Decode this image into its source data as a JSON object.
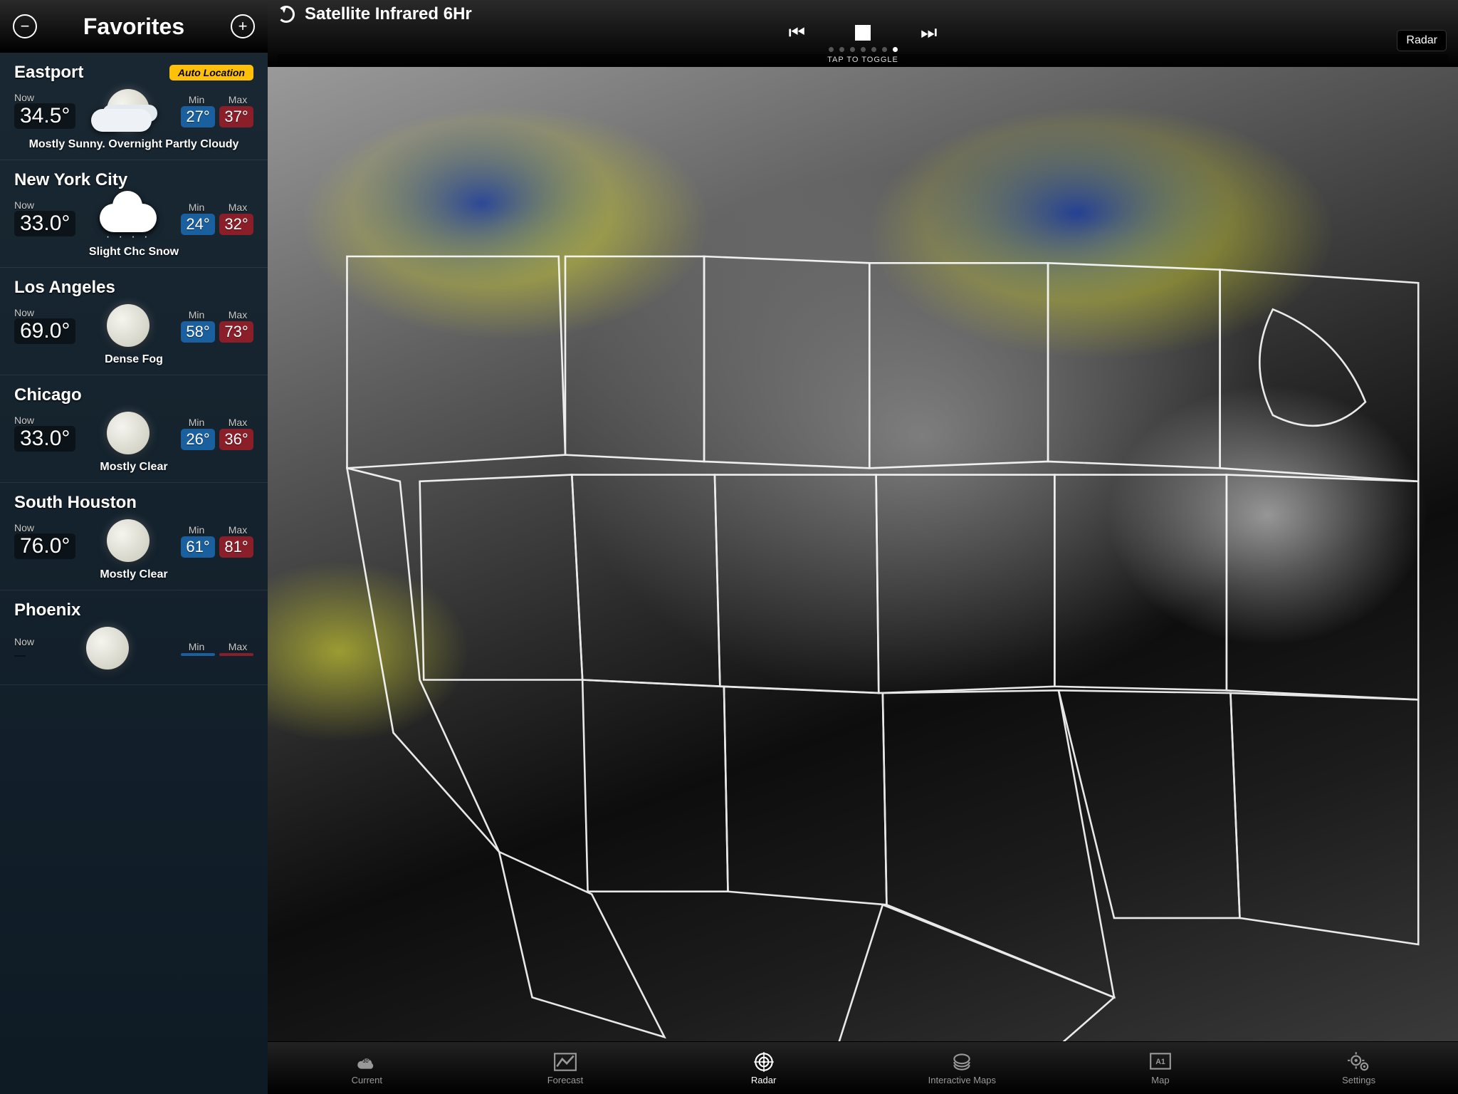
{
  "sidebar": {
    "title": "Favorites",
    "auto_location_label": "Auto Location",
    "now_label": "Now",
    "min_label": "Min",
    "max_label": "Max",
    "items": [
      {
        "name": "Eastport",
        "auto": true,
        "now": "34.5°",
        "min": "27°",
        "max": "37°",
        "icon": "moon-cloudy",
        "desc": "Mostly Sunny. Overnight Partly Cloudy"
      },
      {
        "name": "New York City",
        "auto": false,
        "now": "33.0°",
        "min": "24°",
        "max": "32°",
        "icon": "cloud-snow",
        "desc": "Slight Chc Snow"
      },
      {
        "name": "Los Angeles",
        "auto": false,
        "now": "69.0°",
        "min": "58°",
        "max": "73°",
        "icon": "moon",
        "desc": "Dense Fog"
      },
      {
        "name": "Chicago",
        "auto": false,
        "now": "33.0°",
        "min": "26°",
        "max": "36°",
        "icon": "moon",
        "desc": "Mostly Clear"
      },
      {
        "name": "South Houston",
        "auto": false,
        "now": "76.0°",
        "min": "61°",
        "max": "81°",
        "icon": "moon",
        "desc": "Mostly Clear"
      },
      {
        "name": "Phoenix",
        "auto": false,
        "now": "",
        "min": "",
        "max": "",
        "icon": "moon",
        "desc": ""
      }
    ]
  },
  "topbar": {
    "title": "Satellite Infrared 6Hr",
    "radar_button": "Radar",
    "tap_toggle": "TAP TO TOGGLE",
    "frames": 7,
    "active_frame": 6
  },
  "tabs": [
    {
      "id": "current",
      "label": "Current",
      "icon": "cloud-temp"
    },
    {
      "id": "forecast",
      "label": "Forecast",
      "icon": "chart-line"
    },
    {
      "id": "radar",
      "label": "Radar",
      "icon": "target",
      "active": true
    },
    {
      "id": "interactive",
      "label": "Interactive Maps",
      "icon": "globe-layers"
    },
    {
      "id": "map",
      "label": "Map",
      "icon": "map-a1"
    },
    {
      "id": "settings",
      "label": "Settings",
      "icon": "gears"
    }
  ]
}
